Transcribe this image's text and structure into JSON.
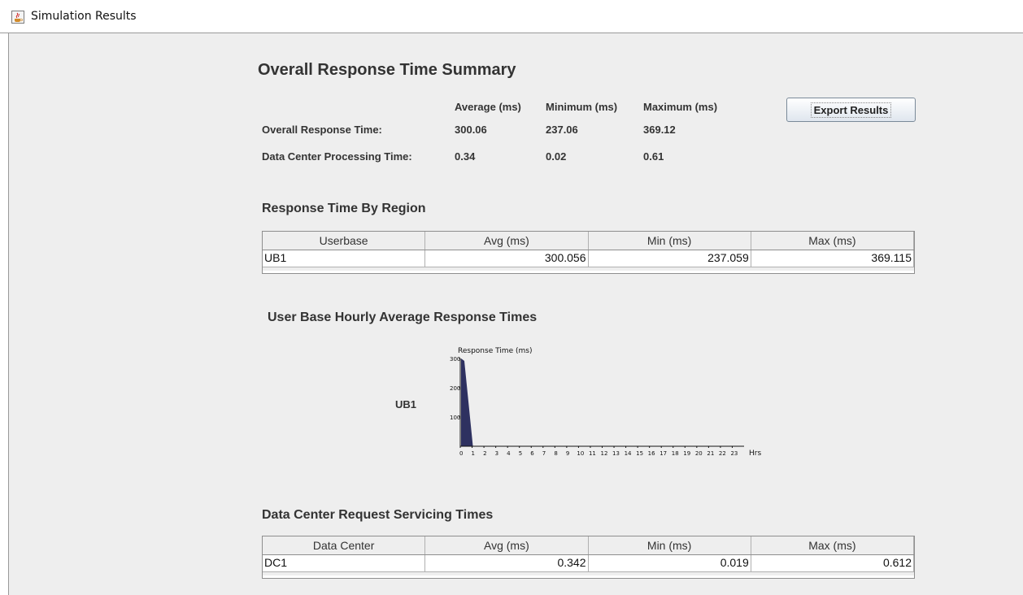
{
  "window": {
    "title": "Simulation Results",
    "icon": "java-coffee-icon"
  },
  "summary": {
    "title": "Overall Response Time Summary",
    "col_avg": "Average (ms)",
    "col_min": "Minimum (ms)",
    "col_max": "Maximum (ms)",
    "export_label": "Export Results",
    "rows": [
      {
        "label": "Overall Response Time:",
        "avg": "300.06",
        "min": "237.06",
        "max": "369.12"
      },
      {
        "label": "Data Center Processing Time:",
        "avg": "0.34",
        "min": "0.02",
        "max": "0.61"
      }
    ]
  },
  "region": {
    "title": "Response Time By Region",
    "headers": [
      "Userbase",
      "Avg (ms)",
      "Min (ms)",
      "Max (ms)"
    ],
    "rows": [
      [
        "UB1",
        "300.056",
        "237.059",
        "369.115"
      ]
    ]
  },
  "hourly": {
    "title": "User Base Hourly Average Response Times",
    "userbase_label": "UB1"
  },
  "chart_data": {
    "type": "bar",
    "title": "",
    "ylabel": "Response Time (ms)",
    "xlabel": "Hrs",
    "ylim": [
      0,
      300
    ],
    "yticks": [
      "100",
      "200",
      "300"
    ],
    "categories": [
      "0",
      "1",
      "2",
      "3",
      "4",
      "5",
      "6",
      "7",
      "8",
      "9",
      "10",
      "11",
      "12",
      "13",
      "14",
      "15",
      "16",
      "17",
      "18",
      "19",
      "20",
      "21",
      "22",
      "23"
    ],
    "series": [
      {
        "name": "UB1",
        "values": [
          300,
          0,
          0,
          0,
          0,
          0,
          0,
          0,
          0,
          0,
          0,
          0,
          0,
          0,
          0,
          0,
          0,
          0,
          0,
          0,
          0,
          0,
          0,
          0
        ]
      }
    ],
    "bar_color": "#2e3160"
  },
  "datacenter": {
    "title": "Data Center Request Servicing Times",
    "headers": [
      "Data Center",
      "Avg (ms)",
      "Min (ms)",
      "Max (ms)"
    ],
    "rows": [
      [
        "DC1",
        "0.342",
        "0.019",
        "0.612"
      ]
    ]
  }
}
